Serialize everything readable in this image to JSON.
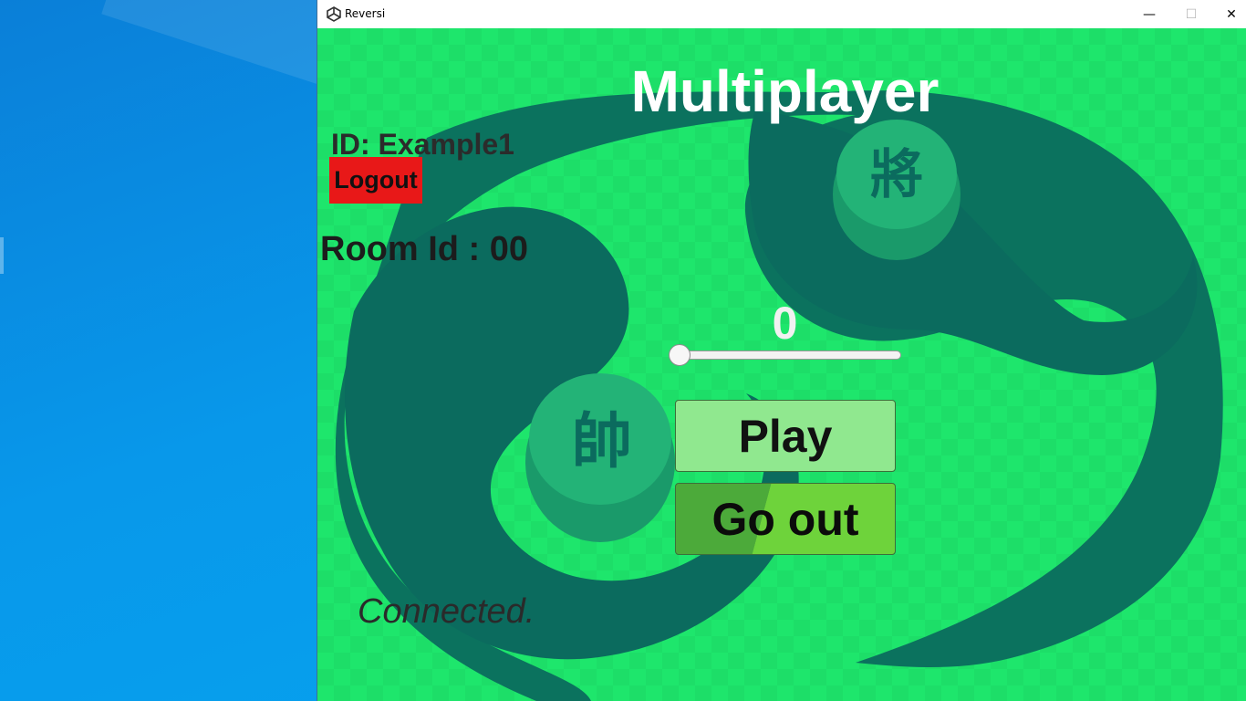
{
  "window": {
    "title": "Reversi",
    "minimize_glyph": "—",
    "maximize_glyph": "☐",
    "close_glyph": "✕"
  },
  "game": {
    "heading": "Multiplayer",
    "user_id": "ID: Example1",
    "logout_label": "Logout",
    "room_id": "Room Id : 00",
    "slider_value": "0",
    "slider_fraction": 0,
    "play_label": "Play",
    "go_out_label": "Go out",
    "status": "Connected.",
    "piece_top_char": "將",
    "piece_bottom_char": "帥"
  },
  "colors": {
    "background_green": "#1ee66c",
    "swirl_teal": "#0b6b5e",
    "logout_red": "#e81818",
    "play_button": "#90e88f",
    "go_out_button": "#6ed33b"
  },
  "icons": {
    "app": "unity-icon"
  }
}
